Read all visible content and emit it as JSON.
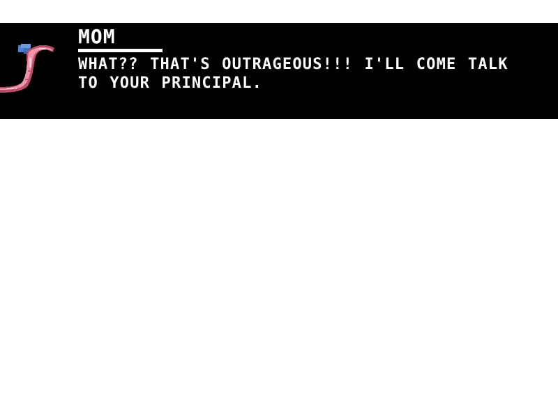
{
  "dialogue": {
    "speaker": "MOM",
    "text": "WHAT?? THAT'S OUTRAGEOUS!!! I'LL COME TALK TO YOUR PRINCIPAL."
  },
  "portrait": {
    "icon": "worm-mom-portrait-icon",
    "body_color": "#e8829a",
    "hat_color": "#5b8fd6"
  },
  "colors": {
    "box_background": "#000000",
    "text": "#ffffff",
    "screen_background": "#ffffff"
  }
}
